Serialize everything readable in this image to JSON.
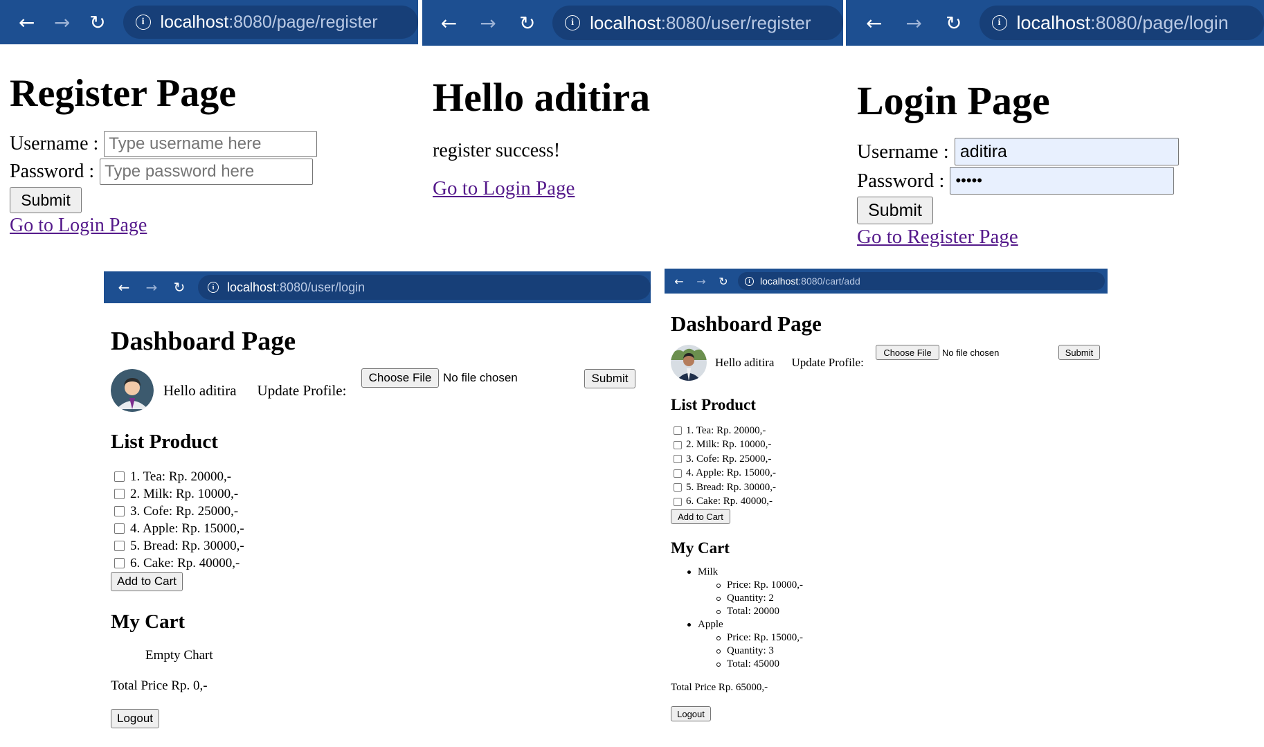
{
  "register_window": {
    "url_host": "localhost",
    "url_path": ":8080/page/register",
    "title": "Register Page",
    "username_label": "Username :",
    "username_placeholder": "Type username here",
    "password_label": "Password :",
    "password_placeholder": "Type password here",
    "submit_label": "Submit",
    "login_link": "Go to Login Page"
  },
  "register_success_window": {
    "url_host": "localhost",
    "url_path": ":8080/user/register",
    "title": "Hello aditira",
    "message": "register success!",
    "login_link": "Go to Login Page"
  },
  "login_window": {
    "url_host": "localhost",
    "url_path": ":8080/page/login",
    "title": "Login Page",
    "username_label": "Username :",
    "username_value": "aditira",
    "password_label": "Password :",
    "password_value": "•••••",
    "submit_label": "Submit",
    "register_link": "Go to Register Page"
  },
  "dashboard_login_window": {
    "url_host": "localhost",
    "url_path": ":8080/user/login",
    "title": "Dashboard Page",
    "greeting": "Hello aditira",
    "update_profile_label": "Update Profile:",
    "choose_file_label": "Choose File",
    "no_file_text": "No file chosen",
    "submit_label": "Submit",
    "list_title": "List Product",
    "products": [
      {
        "label": "1. Tea: Rp. 20000,-"
      },
      {
        "label": "2. Milk: Rp. 10000,-"
      },
      {
        "label": "3. Cofe: Rp. 25000,-"
      },
      {
        "label": "4. Apple: Rp. 15000,-"
      },
      {
        "label": "5. Bread: Rp. 30000,-"
      },
      {
        "label": "6. Cake: Rp. 40000,-"
      }
    ],
    "add_to_cart_label": "Add to Cart",
    "cart_title": "My Cart",
    "cart_empty_text": "Empty Chart",
    "total_text": "Total Price Rp. 0,-",
    "logout_label": "Logout"
  },
  "dashboard_cart_window": {
    "url_host": "localhost",
    "url_path": ":8080/cart/add",
    "title": "Dashboard Page",
    "greeting": "Hello aditira",
    "update_profile_label": "Update Profile:",
    "choose_file_label": "Choose File",
    "no_file_text": "No file chosen",
    "submit_label": "Submit",
    "list_title": "List Product",
    "products": [
      {
        "label": "1. Tea: Rp. 20000,-"
      },
      {
        "label": "2. Milk: Rp. 10000,-"
      },
      {
        "label": "3. Cofe: Rp. 25000,-"
      },
      {
        "label": "4. Apple: Rp. 15000,-"
      },
      {
        "label": "5. Bread: Rp. 30000,-"
      },
      {
        "label": "6. Cake: Rp. 40000,-"
      }
    ],
    "add_to_cart_label": "Add to Cart",
    "cart_title": "My Cart",
    "cart_items": [
      {
        "name": "Milk",
        "price": "Price: Rp. 10000,-",
        "quantity": "Quantity: 2",
        "total": "Total: 20000"
      },
      {
        "name": "Apple",
        "price": "Price: Rp. 15000,-",
        "quantity": "Quantity: 3",
        "total": "Total: 45000"
      }
    ],
    "total_text": "Total Price Rp. 65000,-",
    "logout_label": "Logout"
  },
  "colors": {
    "toolbar": "#1d4f91",
    "link_visited": "#551a8b",
    "autofill": "#e8f0fe"
  },
  "icons": [
    "back-arrow-icon",
    "forward-arrow-icon",
    "reload-icon",
    "info-icon",
    "avatar-icon",
    "checkbox-icon",
    "bullet-icon"
  ]
}
